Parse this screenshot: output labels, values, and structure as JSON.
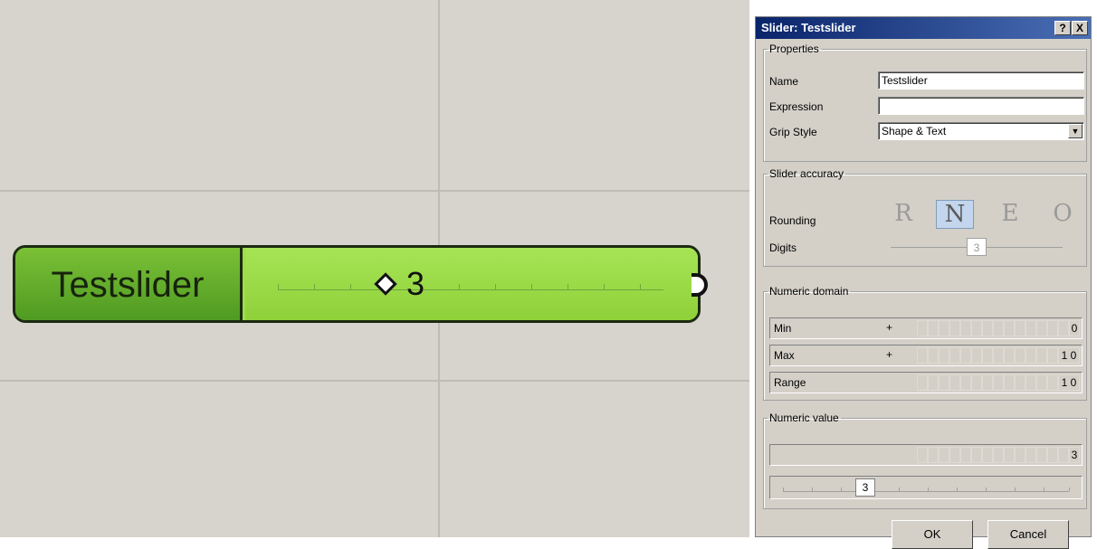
{
  "canvas": {
    "node": {
      "name": "Testslider",
      "value": "3"
    }
  },
  "dialog": {
    "title": "Slider: Testslider",
    "help_label": "?",
    "close_label": "X",
    "properties": {
      "legend": "Properties",
      "name_label": "Name",
      "name_value": "Testslider",
      "expression_label": "Expression",
      "expression_value": "",
      "grip_style_label": "Grip Style",
      "grip_style_value": "Shape & Text"
    },
    "accuracy": {
      "legend": "Slider accuracy",
      "rounding_label": "Rounding",
      "rounding_options": [
        "R",
        "N",
        "E",
        "O"
      ],
      "rounding_selected": "N",
      "digits_label": "Digits",
      "digits_value": "3"
    },
    "domain": {
      "legend": "Numeric domain",
      "min_label": "Min",
      "min_sign": "+",
      "min_value": "0",
      "max_label": "Max",
      "max_sign": "+",
      "max_value": "1 0",
      "range_label": "Range",
      "range_value": "1 0"
    },
    "numeric_value": {
      "legend": "Numeric value",
      "value": "3",
      "slider_value": "3",
      "slider_position": 0.3
    },
    "buttons": {
      "ok": "OK",
      "cancel": "Cancel"
    }
  }
}
